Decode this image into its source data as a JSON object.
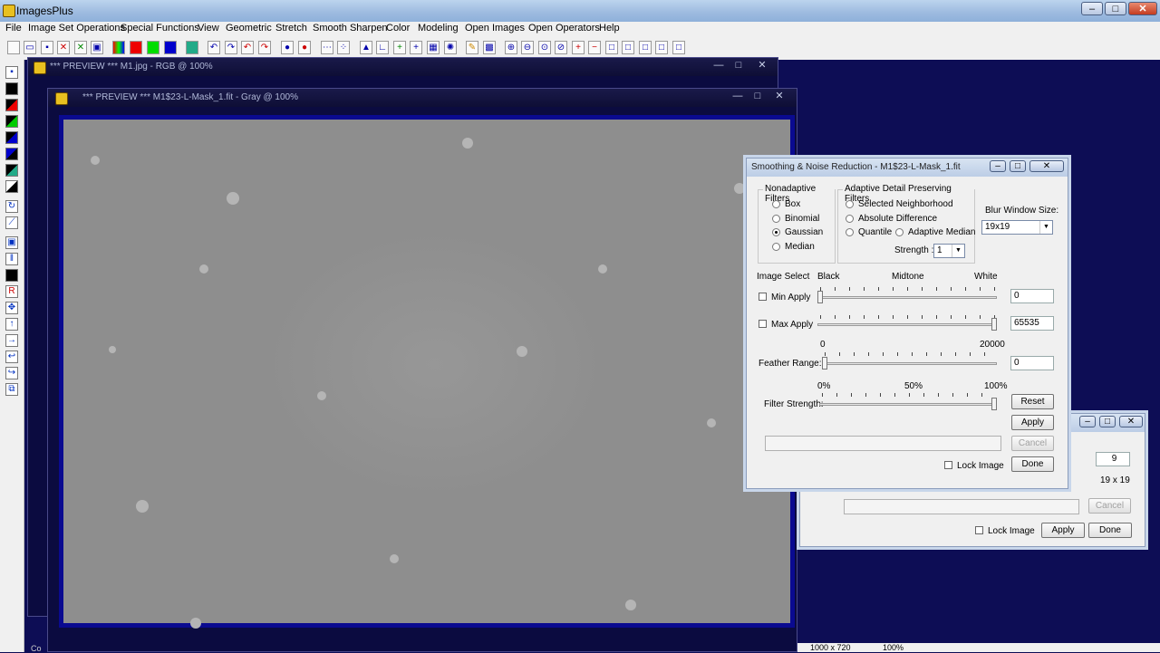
{
  "app": {
    "title": "ImagesPlus"
  },
  "menu": [
    "File",
    "Image Set Operations",
    "Special Functions",
    "View",
    "Geometric",
    "Stretch",
    "Smooth Sharpen",
    "Color",
    "Modeling",
    "Open Images",
    "Open Operators",
    "Help"
  ],
  "windows": {
    "back": {
      "title": "*** PREVIEW *** M1.jpg - RGB @ 100%"
    },
    "front": {
      "title": "*** PREVIEW *** M1$23-L-Mask_1.fit - Gray @ 100%"
    }
  },
  "dialog": {
    "title": "Smoothing & Noise Reduction - M1$23-L-Mask_1.fit",
    "nonadaptive": {
      "label": "Nonadaptive Filters",
      "options": [
        "Box",
        "Binomial",
        "Gaussian",
        "Median"
      ],
      "selected": "Gaussian"
    },
    "adaptive": {
      "label": "Adaptive Detail Preserving Filters",
      "selected_neighborhood": "Selected Neighborhood",
      "absolute_difference": "Absolute Difference",
      "quantile": "Quantile",
      "adaptive_median": "Adaptive Median",
      "strength_label": "Strength :",
      "strength_value": "1"
    },
    "blur": {
      "label": "Blur Window Size:",
      "value": "19x19"
    },
    "image_select": {
      "label": "Image Select",
      "black": "Black",
      "midtone": "Midtone",
      "white": "White"
    },
    "min_apply": {
      "label": "Min Apply",
      "value": "0",
      "checked": false,
      "level": 0.0
    },
    "max_apply": {
      "label": "Max Apply",
      "value": "65535",
      "checked": false,
      "level": 1.0
    },
    "feather": {
      "label": "Feather Range:",
      "min": "0",
      "max": "20000",
      "value": "0",
      "level": 0.0
    },
    "strength": {
      "label": "Filter Strength:",
      "p0": "0%",
      "p50": "50%",
      "p100": "100%",
      "level": 1.0
    },
    "buttons": {
      "reset": "Reset",
      "apply": "Apply",
      "cancel": "Cancel",
      "done": "Done"
    },
    "lock_image": "Lock Image"
  },
  "dialog2": {
    "field_value": "9",
    "size_text": "19 x 19",
    "buttons": {
      "cancel": "Cancel",
      "apply": "Apply",
      "done": "Done"
    },
    "lock_image": "Lock Image"
  },
  "status": {
    "bottom_left": "Co",
    "dims": "1000 x 720",
    "zoom": "100%"
  }
}
